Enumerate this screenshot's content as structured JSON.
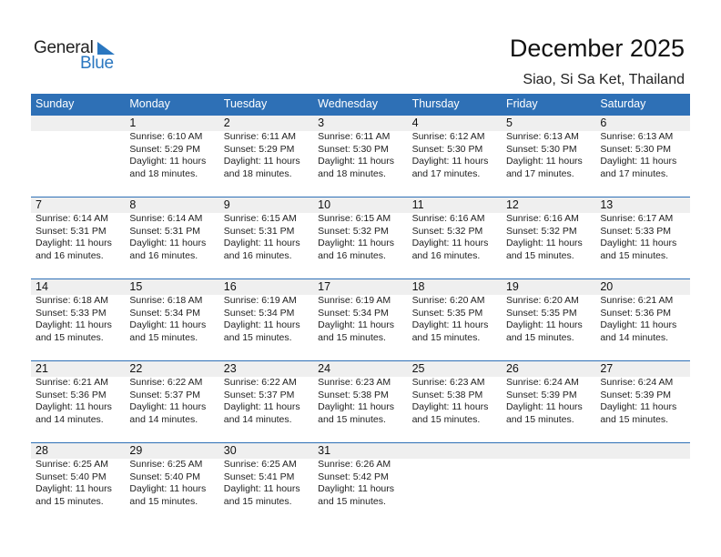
{
  "logo": {
    "line1": "General",
    "line2": "Blue"
  },
  "header": {
    "title": "December 2025",
    "location": "Siao, Si Sa Ket, Thailand"
  },
  "colors": {
    "accent": "#2e70b6",
    "day_bar": "#efefef"
  },
  "weekdays": [
    "Sunday",
    "Monday",
    "Tuesday",
    "Wednesday",
    "Thursday",
    "Friday",
    "Saturday"
  ],
  "weeks": [
    [
      null,
      {
        "day": "1",
        "sunrise": "Sunrise: 6:10 AM",
        "sunset": "Sunset: 5:29 PM",
        "daylight1": "Daylight: 11 hours",
        "daylight2": "and 18 minutes."
      },
      {
        "day": "2",
        "sunrise": "Sunrise: 6:11 AM",
        "sunset": "Sunset: 5:29 PM",
        "daylight1": "Daylight: 11 hours",
        "daylight2": "and 18 minutes."
      },
      {
        "day": "3",
        "sunrise": "Sunrise: 6:11 AM",
        "sunset": "Sunset: 5:30 PM",
        "daylight1": "Daylight: 11 hours",
        "daylight2": "and 18 minutes."
      },
      {
        "day": "4",
        "sunrise": "Sunrise: 6:12 AM",
        "sunset": "Sunset: 5:30 PM",
        "daylight1": "Daylight: 11 hours",
        "daylight2": "and 17 minutes."
      },
      {
        "day": "5",
        "sunrise": "Sunrise: 6:13 AM",
        "sunset": "Sunset: 5:30 PM",
        "daylight1": "Daylight: 11 hours",
        "daylight2": "and 17 minutes."
      },
      {
        "day": "6",
        "sunrise": "Sunrise: 6:13 AM",
        "sunset": "Sunset: 5:30 PM",
        "daylight1": "Daylight: 11 hours",
        "daylight2": "and 17 minutes."
      }
    ],
    [
      {
        "day": "7",
        "sunrise": "Sunrise: 6:14 AM",
        "sunset": "Sunset: 5:31 PM",
        "daylight1": "Daylight: 11 hours",
        "daylight2": "and 16 minutes."
      },
      {
        "day": "8",
        "sunrise": "Sunrise: 6:14 AM",
        "sunset": "Sunset: 5:31 PM",
        "daylight1": "Daylight: 11 hours",
        "daylight2": "and 16 minutes."
      },
      {
        "day": "9",
        "sunrise": "Sunrise: 6:15 AM",
        "sunset": "Sunset: 5:31 PM",
        "daylight1": "Daylight: 11 hours",
        "daylight2": "and 16 minutes."
      },
      {
        "day": "10",
        "sunrise": "Sunrise: 6:15 AM",
        "sunset": "Sunset: 5:32 PM",
        "daylight1": "Daylight: 11 hours",
        "daylight2": "and 16 minutes."
      },
      {
        "day": "11",
        "sunrise": "Sunrise: 6:16 AM",
        "sunset": "Sunset: 5:32 PM",
        "daylight1": "Daylight: 11 hours",
        "daylight2": "and 16 minutes."
      },
      {
        "day": "12",
        "sunrise": "Sunrise: 6:16 AM",
        "sunset": "Sunset: 5:32 PM",
        "daylight1": "Daylight: 11 hours",
        "daylight2": "and 15 minutes."
      },
      {
        "day": "13",
        "sunrise": "Sunrise: 6:17 AM",
        "sunset": "Sunset: 5:33 PM",
        "daylight1": "Daylight: 11 hours",
        "daylight2": "and 15 minutes."
      }
    ],
    [
      {
        "day": "14",
        "sunrise": "Sunrise: 6:18 AM",
        "sunset": "Sunset: 5:33 PM",
        "daylight1": "Daylight: 11 hours",
        "daylight2": "and 15 minutes."
      },
      {
        "day": "15",
        "sunrise": "Sunrise: 6:18 AM",
        "sunset": "Sunset: 5:34 PM",
        "daylight1": "Daylight: 11 hours",
        "daylight2": "and 15 minutes."
      },
      {
        "day": "16",
        "sunrise": "Sunrise: 6:19 AM",
        "sunset": "Sunset: 5:34 PM",
        "daylight1": "Daylight: 11 hours",
        "daylight2": "and 15 minutes."
      },
      {
        "day": "17",
        "sunrise": "Sunrise: 6:19 AM",
        "sunset": "Sunset: 5:34 PM",
        "daylight1": "Daylight: 11 hours",
        "daylight2": "and 15 minutes."
      },
      {
        "day": "18",
        "sunrise": "Sunrise: 6:20 AM",
        "sunset": "Sunset: 5:35 PM",
        "daylight1": "Daylight: 11 hours",
        "daylight2": "and 15 minutes."
      },
      {
        "day": "19",
        "sunrise": "Sunrise: 6:20 AM",
        "sunset": "Sunset: 5:35 PM",
        "daylight1": "Daylight: 11 hours",
        "daylight2": "and 15 minutes."
      },
      {
        "day": "20",
        "sunrise": "Sunrise: 6:21 AM",
        "sunset": "Sunset: 5:36 PM",
        "daylight1": "Daylight: 11 hours",
        "daylight2": "and 14 minutes."
      }
    ],
    [
      {
        "day": "21",
        "sunrise": "Sunrise: 6:21 AM",
        "sunset": "Sunset: 5:36 PM",
        "daylight1": "Daylight: 11 hours",
        "daylight2": "and 14 minutes."
      },
      {
        "day": "22",
        "sunrise": "Sunrise: 6:22 AM",
        "sunset": "Sunset: 5:37 PM",
        "daylight1": "Daylight: 11 hours",
        "daylight2": "and 14 minutes."
      },
      {
        "day": "23",
        "sunrise": "Sunrise: 6:22 AM",
        "sunset": "Sunset: 5:37 PM",
        "daylight1": "Daylight: 11 hours",
        "daylight2": "and 14 minutes."
      },
      {
        "day": "24",
        "sunrise": "Sunrise: 6:23 AM",
        "sunset": "Sunset: 5:38 PM",
        "daylight1": "Daylight: 11 hours",
        "daylight2": "and 15 minutes."
      },
      {
        "day": "25",
        "sunrise": "Sunrise: 6:23 AM",
        "sunset": "Sunset: 5:38 PM",
        "daylight1": "Daylight: 11 hours",
        "daylight2": "and 15 minutes."
      },
      {
        "day": "26",
        "sunrise": "Sunrise: 6:24 AM",
        "sunset": "Sunset: 5:39 PM",
        "daylight1": "Daylight: 11 hours",
        "daylight2": "and 15 minutes."
      },
      {
        "day": "27",
        "sunrise": "Sunrise: 6:24 AM",
        "sunset": "Sunset: 5:39 PM",
        "daylight1": "Daylight: 11 hours",
        "daylight2": "and 15 minutes."
      }
    ],
    [
      {
        "day": "28",
        "sunrise": "Sunrise: 6:25 AM",
        "sunset": "Sunset: 5:40 PM",
        "daylight1": "Daylight: 11 hours",
        "daylight2": "and 15 minutes."
      },
      {
        "day": "29",
        "sunrise": "Sunrise: 6:25 AM",
        "sunset": "Sunset: 5:40 PM",
        "daylight1": "Daylight: 11 hours",
        "daylight2": "and 15 minutes."
      },
      {
        "day": "30",
        "sunrise": "Sunrise: 6:25 AM",
        "sunset": "Sunset: 5:41 PM",
        "daylight1": "Daylight: 11 hours",
        "daylight2": "and 15 minutes."
      },
      {
        "day": "31",
        "sunrise": "Sunrise: 6:26 AM",
        "sunset": "Sunset: 5:42 PM",
        "daylight1": "Daylight: 11 hours",
        "daylight2": "and 15 minutes."
      },
      null,
      null,
      null
    ]
  ]
}
